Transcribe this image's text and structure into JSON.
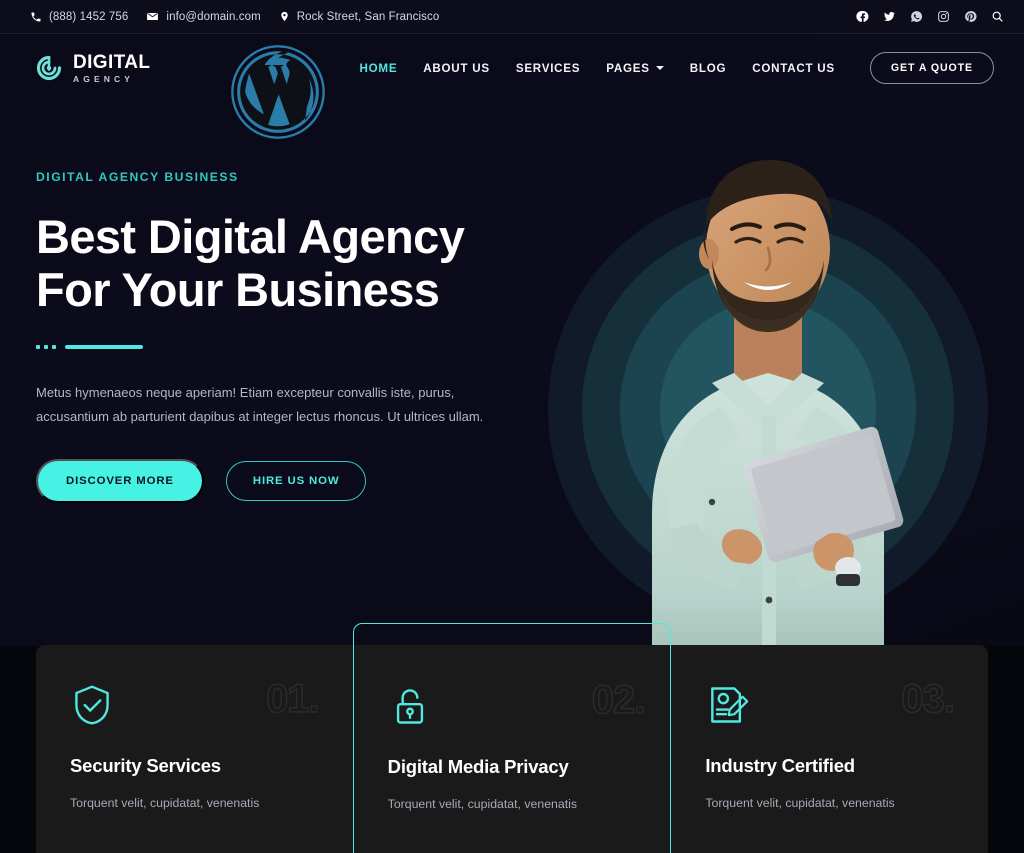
{
  "topbar": {
    "phone": "(888) 1452 756",
    "email": "info@domain.com",
    "address": "Rock Street, San Francisco",
    "phone_icon": "phone-icon",
    "email_icon": "envelope-icon",
    "address_icon": "map-pin-icon",
    "socials": [
      {
        "name": "facebook-icon",
        "label": "Facebook"
      },
      {
        "name": "twitter-icon",
        "label": "Twitter"
      },
      {
        "name": "whatsapp-icon",
        "label": "WhatsApp"
      },
      {
        "name": "instagram-icon",
        "label": "Instagram"
      },
      {
        "name": "pinterest-icon",
        "label": "Pinterest"
      },
      {
        "name": "search-icon",
        "label": "Search"
      }
    ]
  },
  "brand": {
    "name": "DIGITAL",
    "tagline": "AGENCY",
    "watermark": "WordPress"
  },
  "nav": {
    "items": [
      {
        "label": "HOME",
        "active": true,
        "dropdown": false
      },
      {
        "label": "ABOUT US",
        "active": false,
        "dropdown": false
      },
      {
        "label": "SERVICES",
        "active": false,
        "dropdown": false
      },
      {
        "label": "PAGES",
        "active": false,
        "dropdown": true
      },
      {
        "label": "BLOG",
        "active": false,
        "dropdown": false
      },
      {
        "label": "CONTACT US",
        "active": false,
        "dropdown": false
      }
    ],
    "cta_label": "GET A QUOTE"
  },
  "hero": {
    "eyebrow": "DIGITAL AGENCY BUSINESS",
    "title_line1": "Best Digital Agency",
    "title_line2": "For Your Business",
    "description": "Metus hymenaeos neque aperiam! Etiam excepteur convallis iste, purus, accusantium ab parturient dapibus at integer lectus rhoncus. Ut ultrices ullam.",
    "primary_button": "DISCOVER MORE",
    "secondary_button": "HIRE US NOW"
  },
  "features": [
    {
      "number": "01.",
      "title": "Security Services",
      "description": "Torquent velit, cupidatat, venenatis",
      "icon": "shield-check-icon",
      "featured": false
    },
    {
      "number": "02.",
      "title": "Digital Media Privacy",
      "description": "Torquent velit, cupidatat, venenatis",
      "icon": "padlock-icon",
      "featured": true
    },
    {
      "number": "03.",
      "title": "Industry Certified",
      "description": "Torquent velit, cupidatat, venenatis",
      "icon": "certificate-pen-icon",
      "featured": false
    }
  ],
  "colors": {
    "accent": "#4fe9e0",
    "accent_solid": "#45f2e4",
    "accent_dim": "#2fc9c3",
    "bg_dark": "#05050c",
    "hero_bg": "#0a0a18",
    "panel_bg": "#1a1a1a",
    "wordpress_blue": "#2b7ca8"
  }
}
